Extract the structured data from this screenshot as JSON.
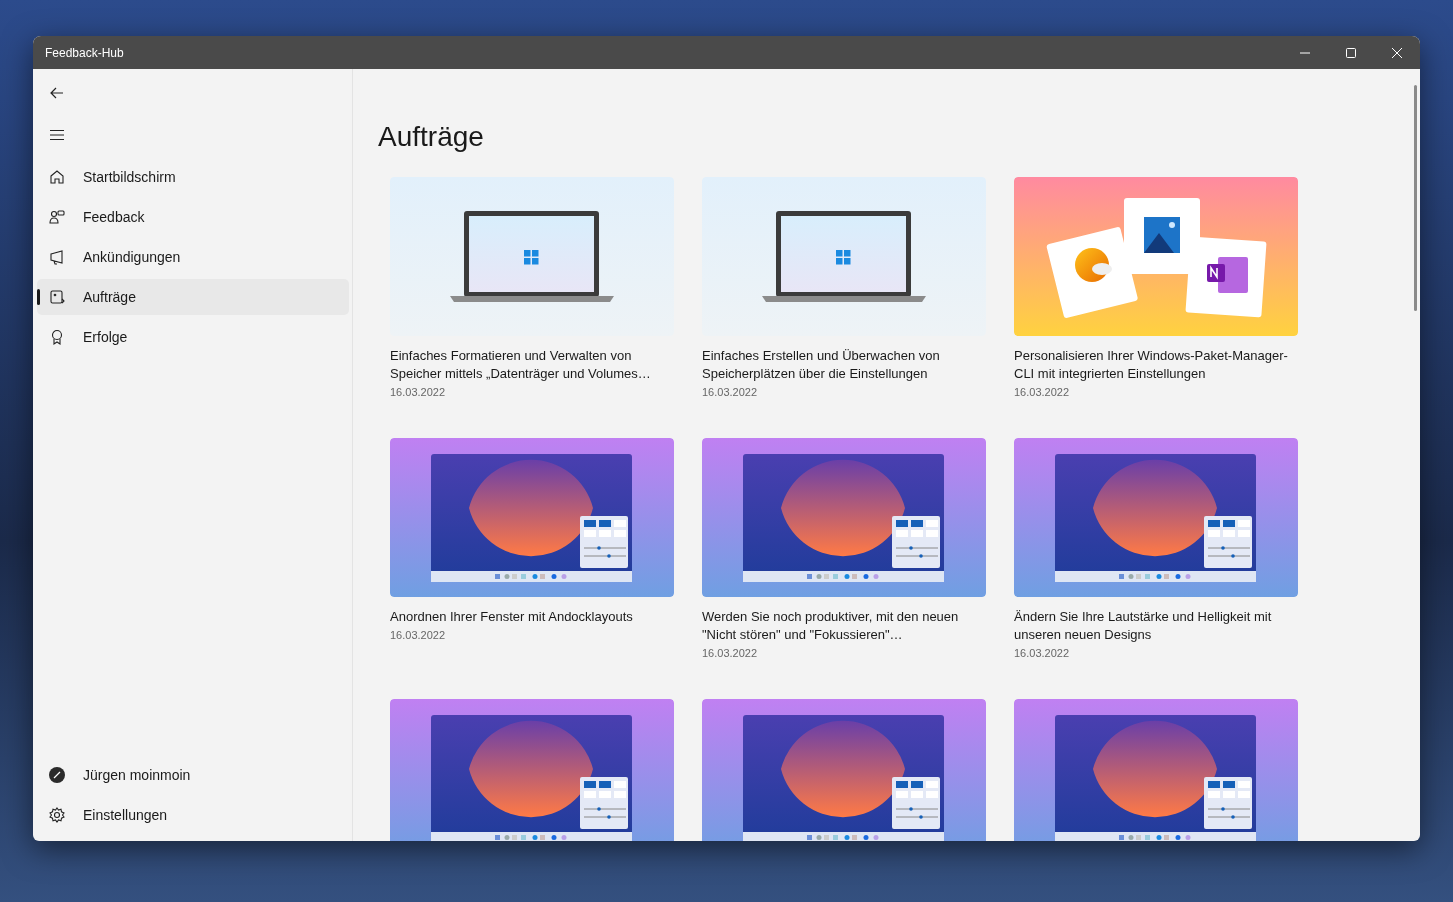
{
  "window": {
    "title": "Feedback-Hub"
  },
  "nav": {
    "items": [
      {
        "label": "Startbildschirm",
        "selected": false
      },
      {
        "label": "Feedback",
        "selected": false
      },
      {
        "label": "Ankündigungen",
        "selected": false
      },
      {
        "label": "Aufträge",
        "selected": true
      },
      {
        "label": "Erfolge",
        "selected": false
      }
    ],
    "footer": [
      {
        "kind": "user",
        "label": "Jürgen moinmoin"
      },
      {
        "kind": "settings",
        "label": "Einstellungen"
      }
    ]
  },
  "page": {
    "heading": "Aufträge"
  },
  "cards": [
    {
      "kind": "laptop",
      "title": "Einfaches Formatieren und Verwalten von Speicher mittels „Datenträger und Volumes…",
      "date": "16.03.2022"
    },
    {
      "kind": "laptop",
      "title": "Einfaches Erstellen und Überwachen von Speicherplätzen über die Einstellungen",
      "date": "16.03.2022"
    },
    {
      "kind": "apps",
      "title": "Personalisieren Ihrer Windows-Paket-Manager-CLI mit integrierten Einstellungen",
      "date": "16.03.2022"
    },
    {
      "kind": "desktop",
      "title": "Anordnen Ihrer Fenster mit Andocklayouts",
      "date": "16.03.2022"
    },
    {
      "kind": "desktop",
      "title": "Werden Sie noch produktiver, mit den neuen \"Nicht stören\" und \"Fokussieren\"…",
      "date": "16.03.2022"
    },
    {
      "kind": "desktop",
      "title": "Ändern Sie Ihre Lautstärke und Helligkeit mit unseren neuen Designs",
      "date": "16.03.2022"
    },
    {
      "kind": "desktop"
    },
    {
      "kind": "desktop"
    },
    {
      "kind": "desktop"
    }
  ]
}
